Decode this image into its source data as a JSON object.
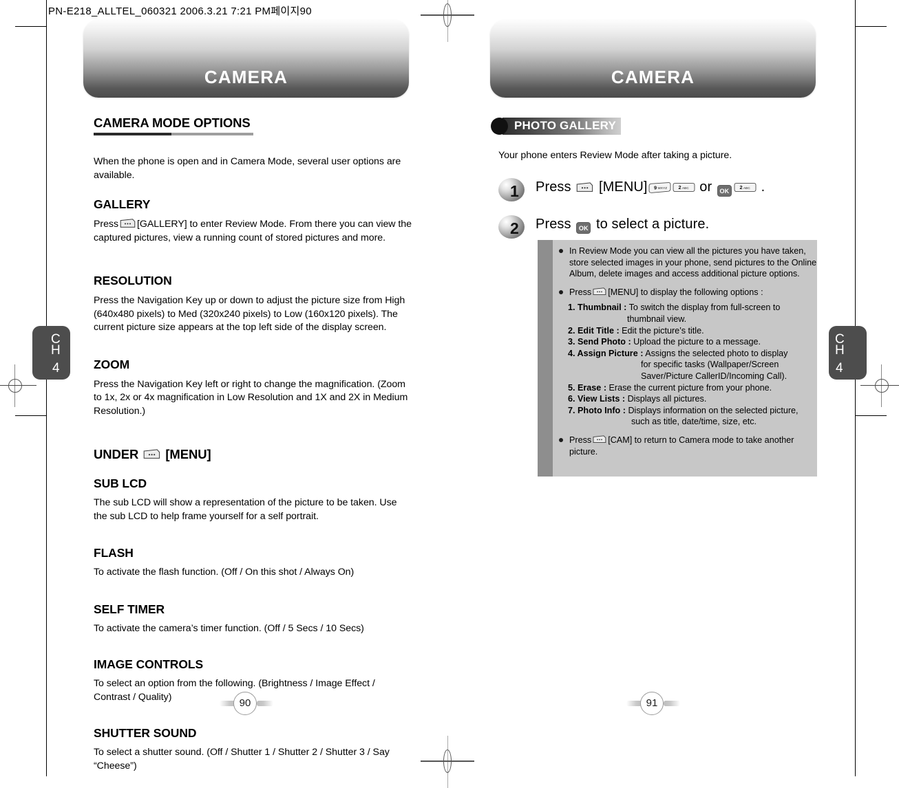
{
  "slug": "PN-E218_ALLTEL_060321  2006.3.21 7:21 PM페이지90",
  "left_page": {
    "banner_title": "CAMERA",
    "chapter_tab": {
      "c": "C",
      "h": "H",
      "number": "4"
    },
    "page_number": "90",
    "section_title": "CAMERA MODE OPTIONS",
    "intro": "When the phone is open and in Camera Mode, several user options are available.",
    "blocks": [
      {
        "heading": "GALLERY",
        "body_pre": "Press",
        "body_post": "[GALLERY] to enter Review Mode. From there you can view the captured pictures, view a running count of stored pictures and more.",
        "icon": "softkey-icon"
      },
      {
        "heading": "RESOLUTION",
        "body": "Press the Navigation Key up or down to adjust the picture size from High (640x480 pixels) to Med (320x240 pixels) to Low (160x120 pixels). The current picture size appears at the top left side of the display screen."
      },
      {
        "heading": "ZOOM",
        "body": "Press the Navigation Key left or right to change the magnification. (Zoom to 1x, 2x or 4x magnification in Low Resolution and 1X and 2X in Medium Resolution.)"
      }
    ],
    "under_menu": {
      "pre": "UNDER",
      "post": "[MENU]",
      "icon": "softkey-icon"
    },
    "menu_blocks": [
      {
        "heading": "SUB LCD",
        "body": "The sub LCD will show a representation of the picture to be taken. Use the sub LCD to help frame yourself for a self portrait."
      },
      {
        "heading": "FLASH",
        "body": "To activate the flash function. (Off / On this shot / Always On)"
      },
      {
        "heading": "SELF TIMER",
        "body": "To activate the camera’s timer function. (Off / 5 Secs / 10 Secs)"
      },
      {
        "heading": "IMAGE CONTROLS",
        "body": "To select an option from the following. (Brightness / Image Effect / Contrast / Quality)"
      },
      {
        "heading": "SHUTTER SOUND",
        "body": "To select a shutter sound. (Off / Shutter 1 / Shutter 2 / Shutter 3 / Say “Cheese”)"
      }
    ]
  },
  "right_page": {
    "banner_title": "CAMERA",
    "chapter_tab": {
      "c": "C",
      "h": "H",
      "number": "4"
    },
    "page_number": "91",
    "gallery_bar_label": "PHOTO GALLERY",
    "intro": "Your phone enters Review Mode after taking a picture.",
    "steps": [
      {
        "number": "1",
        "text_pre": "Press",
        "text_mid": "[MENU]",
        "keys": [
          "9wxyz",
          "2abc"
        ],
        "text_or": "or",
        "ok_label": "OK",
        "key_after_ok": "2abc",
        "text_end": "."
      },
      {
        "number": "2",
        "text_pre": "Press",
        "ok_label": "OK",
        "text_end": "to select a picture."
      }
    ],
    "info_box": {
      "bullets": [
        "In Review Mode you can view all the pictures you have taken, store selected images in your phone, send pictures to the Online Album, delete images and access additional picture options.",
        "Press [MENU] to display the following options :",
        "Press [CAM] to return to Camera mode to take another picture."
      ],
      "bullet2_pre": "Press",
      "bullet2_post": "[MENU] to display the following options :",
      "bullet3_pre": "Press",
      "bullet3_post": "[CAM] to return to Camera mode to take another picture.",
      "options": [
        {
          "label": "1. Thumbnail :",
          "desc": "To switch the display from full-screen to",
          "desc2": "thumbnail view."
        },
        {
          "label": "2. Edit Title :",
          "desc": "Edit the picture’s title.",
          "desc2": ""
        },
        {
          "label": "3. Send Photo :",
          "desc": "Upload the picture to a message.",
          "desc2": ""
        },
        {
          "label": "4. Assign Picture :",
          "desc": "Assigns the selected photo to display",
          "desc2": "for specific tasks (Wallpaper/Screen",
          "desc3": "Saver/Picture CallerID/Incoming Call)."
        },
        {
          "label": "5. Erase :",
          "desc": "Erase the current picture from your phone.",
          "desc2": ""
        },
        {
          "label": "6. View Lists :",
          "desc": "Displays all pictures.",
          "desc2": ""
        },
        {
          "label": "7. Photo Info :",
          "desc": "Displays information on the selected picture,",
          "desc2": "such as title, date/time, size, etc."
        }
      ]
    }
  },
  "colors": {
    "tab_gray": "#4d4d4d",
    "infobox_bg": "#c7c7c7",
    "infobox_bar": "#8e8e8e",
    "rule_dark": "#2b2b2b",
    "rule_light": "#9e9e9e"
  }
}
